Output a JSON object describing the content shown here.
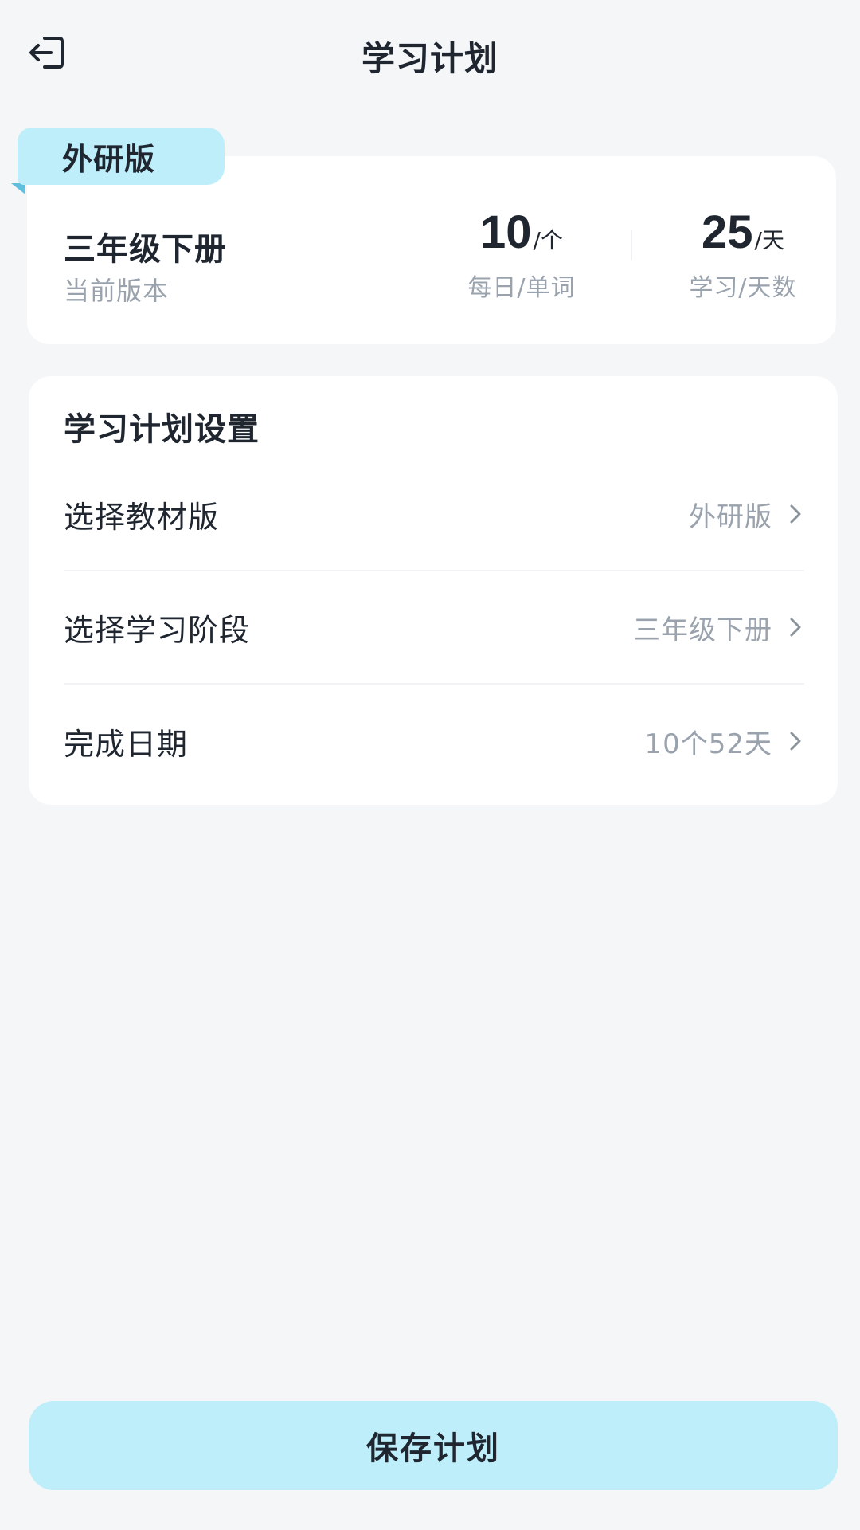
{
  "header": {
    "title": "学习计划",
    "back_icon": "exit-arrow-icon"
  },
  "version_card": {
    "tag": "外研版",
    "grade": "三年级下册",
    "grade_caption": "当前版本",
    "daily_words": {
      "value": "10",
      "unit": "/个",
      "label": "每日/单词"
    },
    "study_days": {
      "value": "25",
      "unit": "/天",
      "label": "学习/天数"
    }
  },
  "settings": {
    "title": "学习计划设置",
    "rows": [
      {
        "label": "选择教材版",
        "value": "外研版",
        "icon": "chevron-right-icon"
      },
      {
        "label": "选择学习阶段",
        "value": "三年级下册",
        "icon": "chevron-right-icon"
      },
      {
        "label": "完成日期",
        "value": "10个52天",
        "icon": "chevron-right-icon"
      }
    ]
  },
  "save_button": {
    "label": "保存计划"
  },
  "colors": {
    "background": "#f4f6f8",
    "accent": "#bdeefa",
    "accent_dark": "#5fbfdc",
    "text_primary": "#1f2630",
    "text_secondary": "#9aa3ad"
  }
}
